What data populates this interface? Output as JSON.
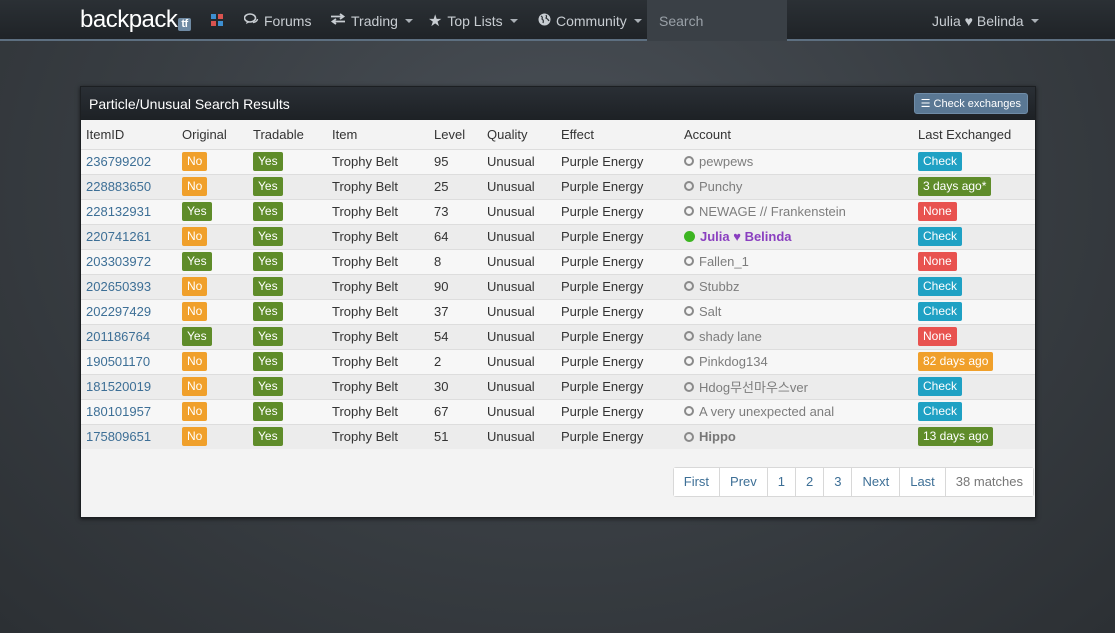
{
  "nav": {
    "brand": "backpack",
    "brand_suffix": "tf",
    "forums": "Forums",
    "trading": "Trading",
    "top_lists": "Top Lists",
    "community": "Community",
    "search_placeholder": "Search",
    "user": "Julia ♥ Belinda"
  },
  "panel": {
    "title": "Particle/Unusual Search Results",
    "check_exchanges": "Check exchanges"
  },
  "table": {
    "headers": [
      "ItemID",
      "Original",
      "Tradable",
      "Item",
      "Level",
      "Quality",
      "Effect",
      "Account",
      "Last Exchanged"
    ],
    "rows": [
      {
        "id": "236799202",
        "original": "No",
        "tradable": "Yes",
        "item": "Trophy Belt",
        "level": "95",
        "quality": "Unusual",
        "effect": "Purple Energy",
        "account": "pewpews",
        "last": "Check"
      },
      {
        "id": "228883650",
        "original": "No",
        "tradable": "Yes",
        "item": "Trophy Belt",
        "level": "25",
        "quality": "Unusual",
        "effect": "Purple Energy",
        "account": "Punchy",
        "last": "3 days ago*"
      },
      {
        "id": "228132931",
        "original": "Yes",
        "tradable": "Yes",
        "item": "Trophy Belt",
        "level": "73",
        "quality": "Unusual",
        "effect": "Purple Energy",
        "account": "NEWAGE // Frankenstein",
        "last": "None"
      },
      {
        "id": "220741261",
        "original": "No",
        "tradable": "Yes",
        "item": "Trophy Belt",
        "level": "64",
        "quality": "Unusual",
        "effect": "Purple Energy",
        "account": "Julia ♥ Belinda",
        "last": "Check"
      },
      {
        "id": "203303972",
        "original": "Yes",
        "tradable": "Yes",
        "item": "Trophy Belt",
        "level": "8",
        "quality": "Unusual",
        "effect": "Purple Energy",
        "account": "Fallen_1",
        "last": "None"
      },
      {
        "id": "202650393",
        "original": "No",
        "tradable": "Yes",
        "item": "Trophy Belt",
        "level": "90",
        "quality": "Unusual",
        "effect": "Purple Energy",
        "account": "Stubbz",
        "last": "Check"
      },
      {
        "id": "202297429",
        "original": "No",
        "tradable": "Yes",
        "item": "Trophy Belt",
        "level": "37",
        "quality": "Unusual",
        "effect": "Purple Energy",
        "account": "Salt",
        "last": "Check"
      },
      {
        "id": "201186764",
        "original": "Yes",
        "tradable": "Yes",
        "item": "Trophy Belt",
        "level": "54",
        "quality": "Unusual",
        "effect": "Purple Energy",
        "account": "shady lane",
        "last": "None"
      },
      {
        "id": "190501170",
        "original": "No",
        "tradable": "Yes",
        "item": "Trophy Belt",
        "level": "2",
        "quality": "Unusual",
        "effect": "Purple Energy",
        "account": "Pinkdog134",
        "last": "82 days ago"
      },
      {
        "id": "181520019",
        "original": "No",
        "tradable": "Yes",
        "item": "Trophy Belt",
        "level": "30",
        "quality": "Unusual",
        "effect": "Purple Energy",
        "account": "Hdog무선마우스ver",
        "last": "Check"
      },
      {
        "id": "180101957",
        "original": "No",
        "tradable": "Yes",
        "item": "Trophy Belt",
        "level": "67",
        "quality": "Unusual",
        "effect": "Purple Energy",
        "account": "A very unexpected anal",
        "last": "Check"
      },
      {
        "id": "175809651",
        "original": "No",
        "tradable": "Yes",
        "item": "Trophy Belt",
        "level": "51",
        "quality": "Unusual",
        "effect": "Purple Energy",
        "account": "Hippo",
        "last": "13 days ago"
      }
    ]
  },
  "pagination": {
    "first": "First",
    "prev": "Prev",
    "p1": "1",
    "p2": "2",
    "p3": "3",
    "next": "Next",
    "last": "Last",
    "matches": "38 matches"
  },
  "colors": {
    "no": "#f0a02b",
    "yes": "#5f8c2a",
    "check": "#1fa1c4",
    "none": "#e8524f",
    "online": "#3cb521",
    "self_name": "#8a3fc0"
  },
  "icons": {
    "forums": "comments-icon",
    "trading": "exchange-icon",
    "top_lists": "star-icon",
    "community": "globe-icon",
    "check_exchanges": "list-icon",
    "status": "circle-icon"
  }
}
